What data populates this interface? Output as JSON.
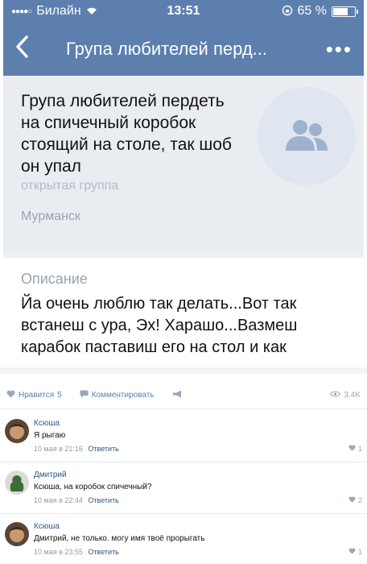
{
  "status_bar": {
    "signal": "●●●●○",
    "carrier": "Билайн",
    "time": "13:51",
    "battery": "65 %",
    "battery_level": 0.65
  },
  "nav": {
    "title": "Група любителей перд..."
  },
  "group": {
    "name": "Група любителей пердеть на спичечный коробок стоящий на столе, так шоб он упал",
    "type": "открытая группа",
    "city": "Мурманск"
  },
  "description": {
    "label": "Описание",
    "text": "Йа очень люблю так делать...Вот так встанеш с ура, Эх! Харашо...Вазмеш карабок паставиш его на стол и как"
  },
  "actions": {
    "like_label": "Нравится",
    "like_count": "5",
    "comment_label": "Комментировать",
    "views": "3.4K"
  },
  "comments": [
    {
      "author": "Ксюша",
      "text": "Я рыгаю",
      "date": "10 мая в 21:16",
      "reply": "Ответить",
      "likes": "1"
    },
    {
      "author": "Дмитрий",
      "text": "Ксюша, на коробок спичечный?",
      "date": "10 мая в 22:44",
      "reply": "Ответить",
      "likes": "2"
    },
    {
      "author": "Ксюша",
      "text": "Дмитрий, не только. могу имя твоё прорыгать",
      "date": "10 мая в 23:55",
      "reply": "Ответить",
      "likes": "1"
    }
  ],
  "colors": {
    "header_blue": "#5c7fae",
    "link_blue": "#2a5885",
    "card_bg": "#e9edf2"
  }
}
